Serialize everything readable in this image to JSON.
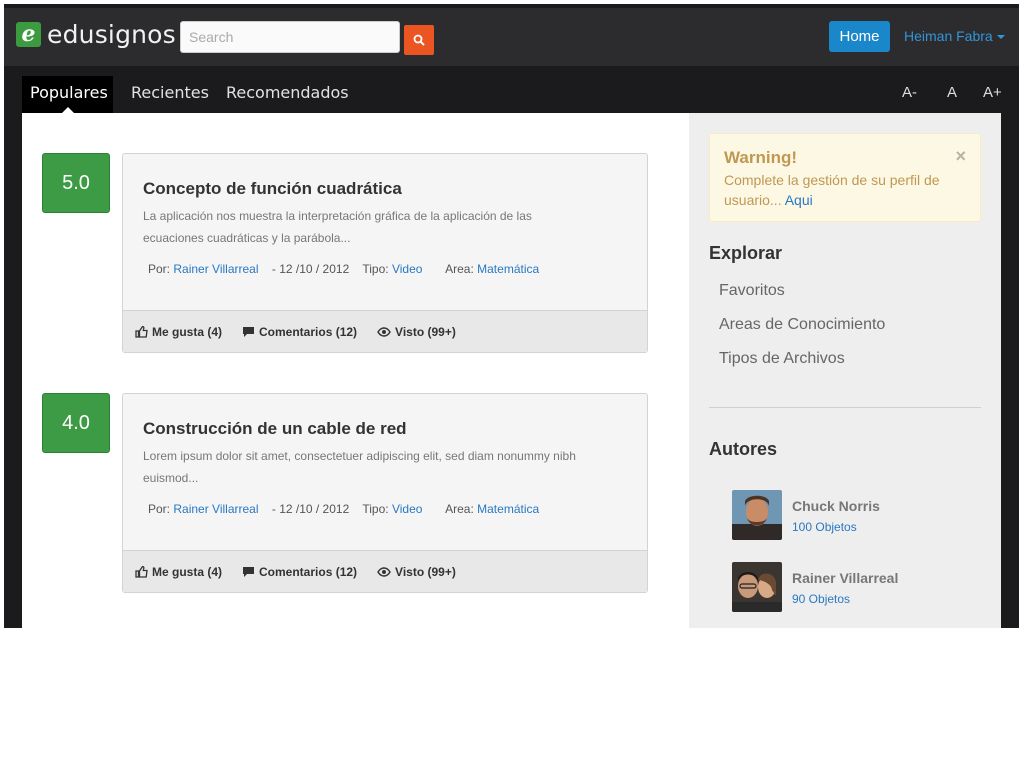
{
  "header": {
    "logo_mark": "e",
    "logo_text": "edusignos",
    "search_placeholder": "Search",
    "home_label": "Home",
    "user_name": "Heiman Fabra"
  },
  "tabs": [
    {
      "label": "Populares",
      "active": true
    },
    {
      "label": "Recientes",
      "active": false
    },
    {
      "label": "Recomendados",
      "active": false
    }
  ],
  "font_controls": [
    "A-",
    "A",
    "A+"
  ],
  "posts": [
    {
      "score": "5.0",
      "title": "Concepto de función cuadrática",
      "description": "La aplicación nos muestra la interpretación gráfica de la aplicación de las ecuaciones cuadráticas y la parábola...",
      "by_label": "Por:",
      "author": "Rainer Villarreal",
      "date": "- 12 /10 / 2012",
      "type_label": "Tipo:",
      "type": "Video",
      "area_label": "Area:",
      "area": "Matemática",
      "likes": "Me gusta (4)",
      "comments": "Comentarios (12)",
      "views": "Visto (99+)"
    },
    {
      "score": "4.0",
      "title": "Construcción de un cable de red",
      "description": "Lorem ipsum dolor sit amet, consectetuer adipiscing elit, sed diam nonummy nibh euismod...",
      "by_label": "Por:",
      "author": "Rainer Villarreal",
      "date": "- 12 /10 / 2012",
      "type_label": "Tipo:",
      "type": "Video",
      "area_label": "Area:",
      "area": "Matemática",
      "likes": "Me gusta (4)",
      "comments": "Comentarios (12)",
      "views": "Visto (99+)"
    }
  ],
  "sidebar": {
    "warning_title": "Warning!",
    "warning_text": "Complete la gestión de su perfil de usuario...",
    "warning_link": "Aqui",
    "close_symbol": "×",
    "explore_title": "Explorar",
    "explore_items": [
      "Favoritos",
      "Areas de Conocimiento",
      "Tipos de Archivos"
    ],
    "authors_title": "Autores",
    "authors": [
      {
        "name": "Chuck Norris",
        "count": "100 Objetos"
      },
      {
        "name": "Rainer Villarreal",
        "count": "90 Objetos"
      }
    ]
  },
  "colors": {
    "brand_green": "#3c9a3f",
    "search_orange": "#ea5521",
    "home_blue": "#1a87cb",
    "link_blue": "#2a78c2"
  }
}
